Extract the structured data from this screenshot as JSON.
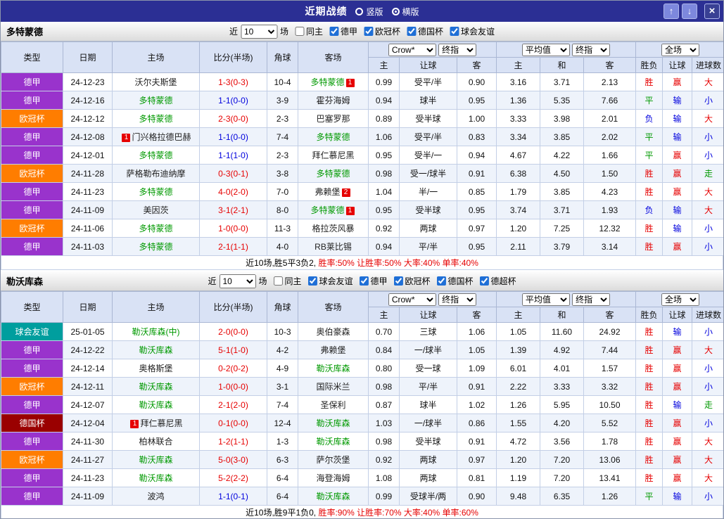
{
  "titlebar": {
    "title": "近期战绩",
    "layout_options": {
      "vertical": "竖版",
      "horizontal": "横版",
      "selected": "横版"
    },
    "icons": {
      "up": "↑",
      "down": "↓",
      "close": "×"
    }
  },
  "table": {
    "columns": [
      "类型",
      "日期",
      "主场",
      "比分(半场)",
      "角球",
      "客场"
    ],
    "asia": {
      "bookmaker": "Crow*",
      "stage": "终指",
      "sub": [
        "主",
        "让球",
        "客"
      ]
    },
    "euro": {
      "avg": "平均值",
      "stage": "终指",
      "sub": [
        "主",
        "和",
        "客"
      ]
    },
    "full": {
      "select": "全场",
      "sub": [
        "胜负",
        "让球",
        "进球数"
      ]
    }
  },
  "colors": {
    "league": {
      "德甲": "#9933cc",
      "欧冠杯": "#ff7d00",
      "德国杯": "#9a0000",
      "球会友谊": "#009e9e"
    },
    "focal_team": "#009900",
    "opponent_team": "#222222",
    "score_win": "#e60000",
    "score_draw": "#0000dd",
    "result": {
      "胜": "#e60000",
      "平": "#009900",
      "负": "#0000dd",
      "赢": "#e60000",
      "输": "#0000dd",
      "走": "#009900",
      "大": "#e60000",
      "小": "#0000dd"
    }
  },
  "sections": [
    {
      "team": "多特蒙德",
      "filter": {
        "prefix": "近",
        "count": "10",
        "suffix": "场",
        "same_home": {
          "label": "同主",
          "checked": false
        },
        "leagues": [
          {
            "label": "德甲",
            "checked": true
          },
          {
            "label": "欧冠杯",
            "checked": true
          },
          {
            "label": "德国杯",
            "checked": true
          },
          {
            "label": "球会友谊",
            "checked": true
          }
        ]
      },
      "rows": [
        {
          "league": "德甲",
          "date": "24-12-23",
          "home": {
            "name": "沃尔夫斯堡",
            "focal": false,
            "badge": ""
          },
          "score": "1-3(0-3)",
          "corner": "10-4",
          "away": {
            "name": "多特蒙德",
            "focal": true,
            "badge": "1"
          },
          "odds": [
            "0.99",
            "受平/半",
            "0.90",
            "3.16",
            "3.71",
            "2.13"
          ],
          "result": [
            "胜",
            "赢",
            "大"
          ]
        },
        {
          "league": "德甲",
          "date": "24-12-16",
          "home": {
            "name": "多特蒙德",
            "focal": true,
            "badge": ""
          },
          "score": "1-1(0-0)",
          "corner": "3-9",
          "away": {
            "name": "霍芬海姆",
            "focal": false,
            "badge": ""
          },
          "odds": [
            "0.94",
            "球半",
            "0.95",
            "1.36",
            "5.35",
            "7.66"
          ],
          "result": [
            "平",
            "输",
            "小"
          ]
        },
        {
          "league": "欧冠杯",
          "date": "24-12-12",
          "home": {
            "name": "多特蒙德",
            "focal": true,
            "badge": ""
          },
          "score": "2-3(0-0)",
          "corner": "2-3",
          "away": {
            "name": "巴塞罗那",
            "focal": false,
            "badge": ""
          },
          "odds": [
            "0.89",
            "受半球",
            "1.00",
            "3.33",
            "3.98",
            "2.01"
          ],
          "result": [
            "负",
            "输",
            "大"
          ]
        },
        {
          "league": "德甲",
          "date": "24-12-08",
          "home": {
            "name": "门兴格拉德巴赫",
            "focal": false,
            "badge": "1"
          },
          "score": "1-1(0-0)",
          "corner": "7-4",
          "away": {
            "name": "多特蒙德",
            "focal": true,
            "badge": ""
          },
          "odds": [
            "1.06",
            "受平/半",
            "0.83",
            "3.34",
            "3.85",
            "2.02"
          ],
          "result": [
            "平",
            "输",
            "小"
          ]
        },
        {
          "league": "德甲",
          "date": "24-12-01",
          "home": {
            "name": "多特蒙德",
            "focal": true,
            "badge": ""
          },
          "score": "1-1(1-0)",
          "corner": "2-3",
          "away": {
            "name": "拜仁慕尼黑",
            "focal": false,
            "badge": ""
          },
          "odds": [
            "0.95",
            "受半/一",
            "0.94",
            "4.67",
            "4.22",
            "1.66"
          ],
          "result": [
            "平",
            "赢",
            "小"
          ]
        },
        {
          "league": "欧冠杯",
          "date": "24-11-28",
          "home": {
            "name": "萨格勒布迪纳摩",
            "focal": false,
            "badge": ""
          },
          "score": "0-3(0-1)",
          "corner": "3-8",
          "away": {
            "name": "多特蒙德",
            "focal": true,
            "badge": ""
          },
          "odds": [
            "0.98",
            "受一/球半",
            "0.91",
            "6.38",
            "4.50",
            "1.50"
          ],
          "result": [
            "胜",
            "赢",
            "走"
          ]
        },
        {
          "league": "德甲",
          "date": "24-11-23",
          "home": {
            "name": "多特蒙德",
            "focal": true,
            "badge": ""
          },
          "score": "4-0(2-0)",
          "corner": "7-0",
          "away": {
            "name": "弗赖堡",
            "focal": false,
            "badge": "2"
          },
          "odds": [
            "1.04",
            "半/一",
            "0.85",
            "1.79",
            "3.85",
            "4.23"
          ],
          "result": [
            "胜",
            "赢",
            "大"
          ]
        },
        {
          "league": "德甲",
          "date": "24-11-09",
          "home": {
            "name": "美因茨",
            "focal": false,
            "badge": ""
          },
          "score": "3-1(2-1)",
          "corner": "8-0",
          "away": {
            "name": "多特蒙德",
            "focal": true,
            "badge": "1"
          },
          "odds": [
            "0.95",
            "受半球",
            "0.95",
            "3.74",
            "3.71",
            "1.93"
          ],
          "result": [
            "负",
            "输",
            "大"
          ]
        },
        {
          "league": "欧冠杯",
          "date": "24-11-06",
          "home": {
            "name": "多特蒙德",
            "focal": true,
            "badge": ""
          },
          "score": "1-0(0-0)",
          "corner": "11-3",
          "away": {
            "name": "格拉茨风暴",
            "focal": false,
            "badge": ""
          },
          "odds": [
            "0.92",
            "两球",
            "0.97",
            "1.20",
            "7.25",
            "12.32"
          ],
          "result": [
            "胜",
            "输",
            "小"
          ]
        },
        {
          "league": "德甲",
          "date": "24-11-03",
          "home": {
            "name": "多特蒙德",
            "focal": true,
            "badge": ""
          },
          "score": "2-1(1-1)",
          "corner": "4-0",
          "away": {
            "name": "RB莱比锡",
            "focal": false,
            "badge": ""
          },
          "odds": [
            "0.94",
            "平/半",
            "0.95",
            "2.11",
            "3.79",
            "3.14"
          ],
          "result": [
            "胜",
            "赢",
            "小"
          ]
        }
      ],
      "summary": [
        {
          "text": "近10场,胜5平3负2, ",
          "color": "#000000"
        },
        {
          "text": "胜率:50%",
          "color": "#e60000"
        },
        {
          "text": " 让胜率:50%",
          "color": "#e60000"
        },
        {
          "text": " 大率:40%",
          "color": "#e60000"
        },
        {
          "text": " 单率:40%",
          "color": "#e60000"
        }
      ]
    },
    {
      "team": "勒沃库森",
      "filter": {
        "prefix": "近",
        "count": "10",
        "suffix": "场",
        "same_home": {
          "label": "同主",
          "checked": false
        },
        "leagues": [
          {
            "label": "球会友谊",
            "checked": true
          },
          {
            "label": "德甲",
            "checked": true
          },
          {
            "label": "欧冠杯",
            "checked": true
          },
          {
            "label": "德国杯",
            "checked": true
          },
          {
            "label": "德超杯",
            "checked": true
          }
        ]
      },
      "rows": [
        {
          "league": "球会友谊",
          "date": "25-01-05",
          "home": {
            "name": "勒沃库森(中)",
            "focal": true,
            "badge": ""
          },
          "score": "2-0(0-0)",
          "corner": "10-3",
          "away": {
            "name": "奥伯豪森",
            "focal": false,
            "badge": ""
          },
          "odds": [
            "0.70",
            "三球",
            "1.06",
            "1.05",
            "11.60",
            "24.92"
          ],
          "result": [
            "胜",
            "输",
            "小"
          ]
        },
        {
          "league": "德甲",
          "date": "24-12-22",
          "home": {
            "name": "勒沃库森",
            "focal": true,
            "badge": ""
          },
          "score": "5-1(1-0)",
          "corner": "4-2",
          "away": {
            "name": "弗赖堡",
            "focal": false,
            "badge": ""
          },
          "odds": [
            "0.84",
            "一/球半",
            "1.05",
            "1.39",
            "4.92",
            "7.44"
          ],
          "result": [
            "胜",
            "赢",
            "大"
          ]
        },
        {
          "league": "德甲",
          "date": "24-12-14",
          "home": {
            "name": "奥格斯堡",
            "focal": false,
            "badge": ""
          },
          "score": "0-2(0-2)",
          "corner": "4-9",
          "away": {
            "name": "勒沃库森",
            "focal": true,
            "badge": ""
          },
          "odds": [
            "0.80",
            "受一球",
            "1.09",
            "6.01",
            "4.01",
            "1.57"
          ],
          "result": [
            "胜",
            "赢",
            "小"
          ]
        },
        {
          "league": "欧冠杯",
          "date": "24-12-11",
          "home": {
            "name": "勒沃库森",
            "focal": true,
            "badge": ""
          },
          "score": "1-0(0-0)",
          "corner": "3-1",
          "away": {
            "name": "国际米兰",
            "focal": false,
            "badge": ""
          },
          "odds": [
            "0.98",
            "平/半",
            "0.91",
            "2.22",
            "3.33",
            "3.32"
          ],
          "result": [
            "胜",
            "赢",
            "小"
          ]
        },
        {
          "league": "德甲",
          "date": "24-12-07",
          "home": {
            "name": "勒沃库森",
            "focal": true,
            "badge": ""
          },
          "score": "2-1(2-0)",
          "corner": "7-4",
          "away": {
            "name": "圣保利",
            "focal": false,
            "badge": ""
          },
          "odds": [
            "0.87",
            "球半",
            "1.02",
            "1.26",
            "5.95",
            "10.50"
          ],
          "result": [
            "胜",
            "输",
            "走"
          ]
        },
        {
          "league": "德国杯",
          "date": "24-12-04",
          "home": {
            "name": "拜仁慕尼黑",
            "focal": false,
            "badge": "1"
          },
          "score": "0-1(0-0)",
          "corner": "12-4",
          "away": {
            "name": "勒沃库森",
            "focal": true,
            "badge": ""
          },
          "odds": [
            "1.03",
            "一/球半",
            "0.86",
            "1.55",
            "4.20",
            "5.52"
          ],
          "result": [
            "胜",
            "赢",
            "小"
          ]
        },
        {
          "league": "德甲",
          "date": "24-11-30",
          "home": {
            "name": "柏林联合",
            "focal": false,
            "badge": ""
          },
          "score": "1-2(1-1)",
          "corner": "1-3",
          "away": {
            "name": "勒沃库森",
            "focal": true,
            "badge": ""
          },
          "odds": [
            "0.98",
            "受半球",
            "0.91",
            "4.72",
            "3.56",
            "1.78"
          ],
          "result": [
            "胜",
            "赢",
            "大"
          ]
        },
        {
          "league": "欧冠杯",
          "date": "24-11-27",
          "home": {
            "name": "勒沃库森",
            "focal": true,
            "badge": ""
          },
          "score": "5-0(3-0)",
          "corner": "6-3",
          "away": {
            "name": "萨尔茨堡",
            "focal": false,
            "badge": ""
          },
          "odds": [
            "0.92",
            "两球",
            "0.97",
            "1.20",
            "7.20",
            "13.06"
          ],
          "result": [
            "胜",
            "赢",
            "大"
          ]
        },
        {
          "league": "德甲",
          "date": "24-11-23",
          "home": {
            "name": "勒沃库森",
            "focal": true,
            "badge": ""
          },
          "score": "5-2(2-2)",
          "corner": "6-4",
          "away": {
            "name": "海登海姆",
            "focal": false,
            "badge": ""
          },
          "odds": [
            "1.08",
            "两球",
            "0.81",
            "1.19",
            "7.20",
            "13.41"
          ],
          "result": [
            "胜",
            "赢",
            "大"
          ]
        },
        {
          "league": "德甲",
          "date": "24-11-09",
          "home": {
            "name": "波鸿",
            "focal": false,
            "badge": ""
          },
          "score": "1-1(0-1)",
          "corner": "6-4",
          "away": {
            "name": "勒沃库森",
            "focal": true,
            "badge": ""
          },
          "odds": [
            "0.99",
            "受球半/两",
            "0.90",
            "9.48",
            "6.35",
            "1.26"
          ],
          "result": [
            "平",
            "输",
            "小"
          ]
        }
      ],
      "summary": [
        {
          "text": "近10场,胜9平1负0, ",
          "color": "#000000"
        },
        {
          "text": "胜率:90%",
          "color": "#e60000"
        },
        {
          "text": " 让胜率:70%",
          "color": "#e60000"
        },
        {
          "text": " 大率:40%",
          "color": "#e60000"
        },
        {
          "text": " 单率:60%",
          "color": "#e60000"
        }
      ]
    }
  ]
}
